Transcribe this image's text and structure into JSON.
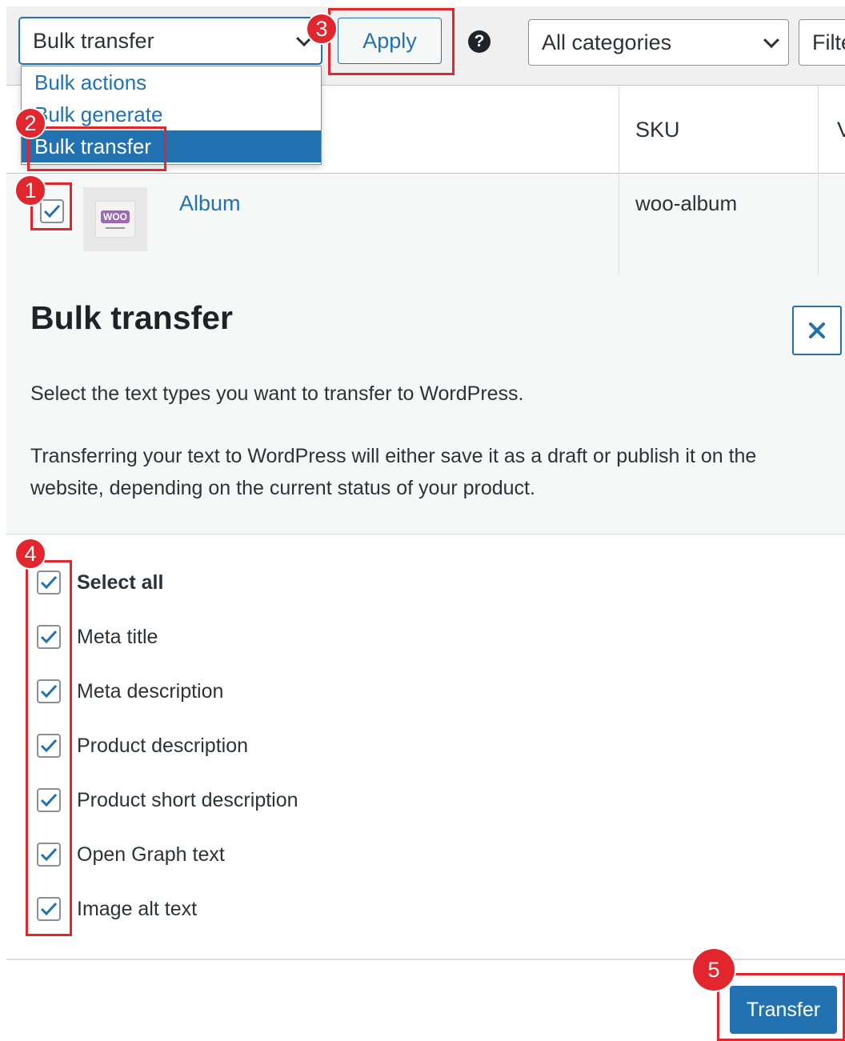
{
  "toolbar": {
    "bulk_select_value": "Bulk transfer",
    "apply_label": "Apply",
    "help_glyph": "?",
    "category_select_value": "All categories",
    "filter_label": "Filter"
  },
  "dropdown": {
    "options": [
      "Bulk actions",
      "Bulk generate",
      "Bulk transfer"
    ],
    "selected": "Bulk transfer"
  },
  "table": {
    "columns": [
      "SKU"
    ],
    "rows": [
      {
        "name": "Album",
        "sku": "woo-album",
        "checked": true,
        "thumbnail": "woo-logo"
      }
    ]
  },
  "modal": {
    "title": "Bulk transfer",
    "intro": "Select the text types you want to transfer to WordPress.",
    "note": "Transferring your text to WordPress will either save it as a draft or publish it on the website, depending on the current status of your product.",
    "options": [
      {
        "label": "Select all",
        "checked": true
      },
      {
        "label": "Meta title",
        "checked": true
      },
      {
        "label": "Meta description",
        "checked": true
      },
      {
        "label": "Product description",
        "checked": true
      },
      {
        "label": "Product short description",
        "checked": true
      },
      {
        "label": "Open Graph text",
        "checked": true
      },
      {
        "label": "Image alt text",
        "checked": true
      }
    ],
    "submit_label": "Transfer"
  },
  "annotations": [
    "1",
    "2",
    "3",
    "4",
    "5"
  ],
  "colors": {
    "accent": "#2271b1",
    "highlight": "#e1262d",
    "check": "#2271b1"
  },
  "icons": {
    "close": "close-icon",
    "chevron": "chevron-down-icon",
    "check": "checkmark-icon",
    "help": "help-icon"
  }
}
